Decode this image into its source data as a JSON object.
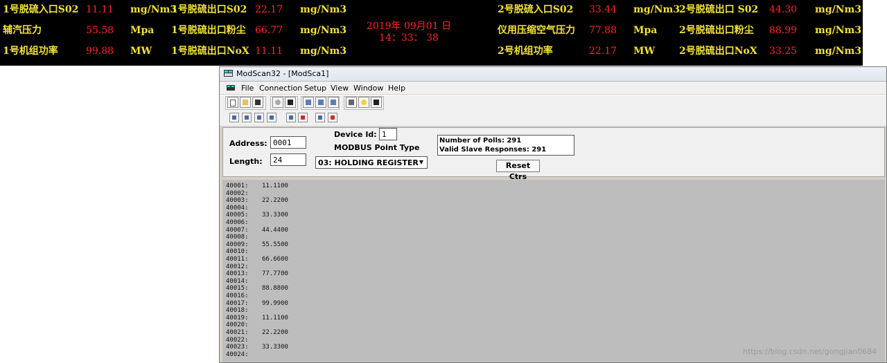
{
  "led_board": {
    "row1": [
      {
        "label": "1号脱硫入口S02",
        "value": "11.11",
        "unit": "mg/Nm3"
      },
      {
        "label": "1号脱硫出口S02",
        "value": "22.17",
        "unit": "mg/Nm3"
      },
      {
        "label": "2号脱硫入口S02",
        "value": "33.44",
        "unit": "mg/Nm3"
      },
      {
        "label": "2号脱硫出口 S02",
        "value": "44.30",
        "unit": "mg/Nm3"
      }
    ],
    "row2": [
      {
        "label": "辅汽压力",
        "value": "55.58",
        "unit": "Mpa"
      },
      {
        "label": "1号脱硫出口粉尘",
        "value": "66.77",
        "unit": "mg/Nm3"
      },
      {
        "label": "仪用压缩空气压力",
        "value": "77.88",
        "unit": "Mpa"
      },
      {
        "label": "2号脱硫出口粉尘",
        "value": "88.99",
        "unit": "mg/Nm3"
      }
    ],
    "row3": [
      {
        "label": "1号机组功率",
        "value": "99.88",
        "unit": "MW"
      },
      {
        "label": "1号脱硫出口NoX",
        "value": "11.11",
        "unit": "mg/Nm3"
      },
      {
        "label": "2号机组功率",
        "value": "22.17",
        "unit": "MW"
      },
      {
        "label": "2号脱硫出口NoX",
        "value": "33.25",
        "unit": "mg/Nm3"
      }
    ],
    "date": "2019年 09月01 日",
    "time": "14：33： 38"
  },
  "window": {
    "title": "ModScan32 - [ModSca1]",
    "menu": [
      "File",
      "Connection",
      "Setup",
      "View",
      "Window",
      "Help"
    ]
  },
  "form": {
    "address_label": "Address:",
    "address_value": "0001",
    "length_label": "Length:",
    "length_value": "24",
    "device_id_label": "Device Id:",
    "device_id_value": "1",
    "point_type_label": "MODBUS Point Type",
    "point_type_value": "03: HOLDING REGISTER",
    "polls": "Number of Polls: 291",
    "responses": "Valid Slave Responses: 291",
    "reset_label": "Reset Ctrs"
  },
  "registers": [
    {
      "addr": "40001:",
      "val": "11.1100"
    },
    {
      "addr": "40002:",
      "val": ""
    },
    {
      "addr": "40003:",
      "val": "22.2200"
    },
    {
      "addr": "40004:",
      "val": ""
    },
    {
      "addr": "40005:",
      "val": "33.3300"
    },
    {
      "addr": "40006:",
      "val": ""
    },
    {
      "addr": "40007:",
      "val": "44.4400"
    },
    {
      "addr": "40008:",
      "val": ""
    },
    {
      "addr": "40009:",
      "val": "55.5500"
    },
    {
      "addr": "40010:",
      "val": ""
    },
    {
      "addr": "40011:",
      "val": "66.6600"
    },
    {
      "addr": "40012:",
      "val": ""
    },
    {
      "addr": "40013:",
      "val": "77.7700"
    },
    {
      "addr": "40014:",
      "val": ""
    },
    {
      "addr": "40015:",
      "val": "88.8800"
    },
    {
      "addr": "40016:",
      "val": ""
    },
    {
      "addr": "40017:",
      "val": "99.9900"
    },
    {
      "addr": "40018:",
      "val": ""
    },
    {
      "addr": "40019:",
      "val": "11.1100"
    },
    {
      "addr": "40020:",
      "val": ""
    },
    {
      "addr": "40021:",
      "val": "22.2200"
    },
    {
      "addr": "40022:",
      "val": ""
    },
    {
      "addr": "40023:",
      "val": "33.3300"
    },
    {
      "addr": "40024:",
      "val": ""
    }
  ],
  "watermark": "https://blog.csdn.net/gongjian0684"
}
